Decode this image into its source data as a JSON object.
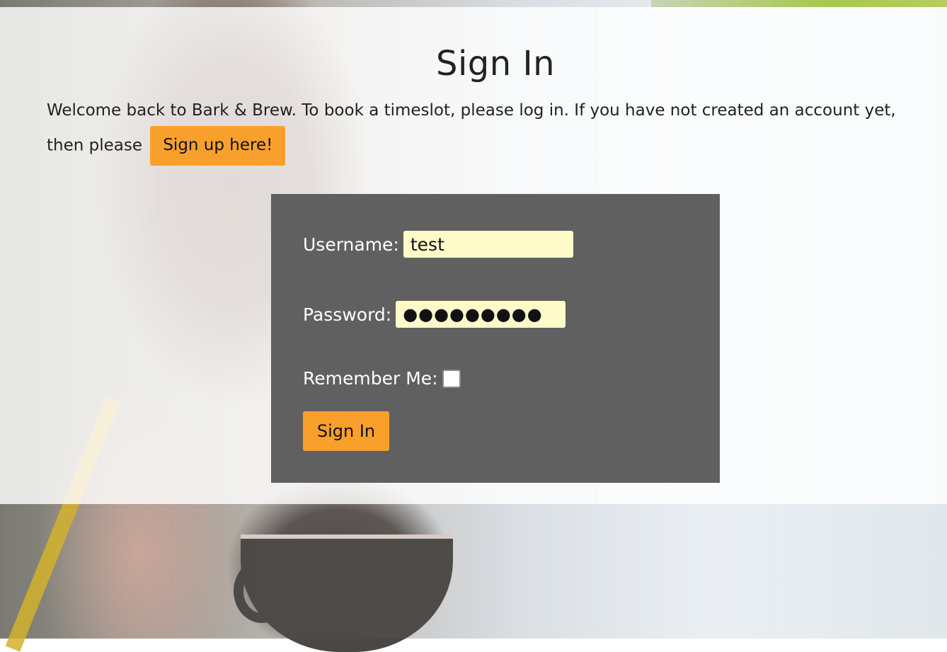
{
  "page": {
    "title": "Sign In",
    "intro_text": "Welcome back to Bark & Brew. To book a timeslot, please log in. If you have not created an account yet, then please",
    "signup_link_label": "Sign up here!"
  },
  "form": {
    "username_label": "Username:",
    "username_value": "test",
    "password_label": "Password:",
    "password_value": "●●●●●●●●●",
    "remember_label": "Remember Me:",
    "remember_checked": false,
    "submit_label": "Sign In"
  },
  "colors": {
    "accent": "#f9a02c",
    "form_background": "#606060",
    "input_background": "#fffbc9",
    "overlay": "rgba(255,255,255,0.82)"
  }
}
